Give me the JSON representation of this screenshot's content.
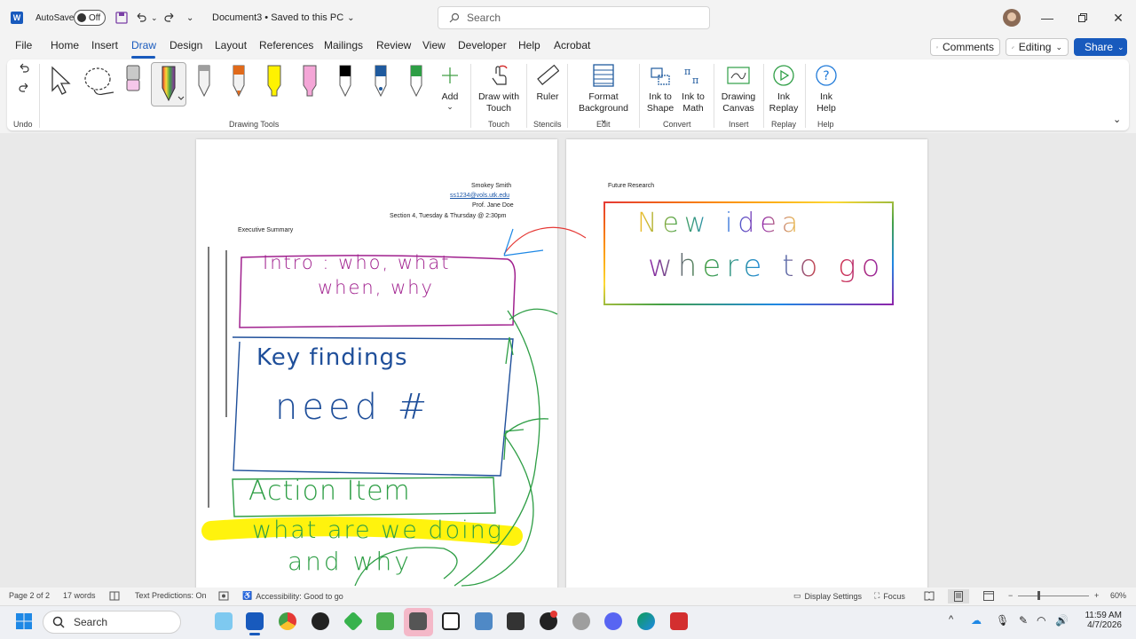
{
  "titlebar": {
    "autosave_label": "AutoSave",
    "autosave_state": "Off",
    "doc_title": "Document3 • Saved to this PC",
    "search_placeholder": "Search"
  },
  "menu": {
    "items": [
      "File",
      "Home",
      "Insert",
      "Draw",
      "Design",
      "Layout",
      "References",
      "Mailings",
      "Review",
      "View",
      "Developer",
      "Help",
      "Acrobat"
    ],
    "active": "Draw",
    "comments_label": "Comments",
    "editing_label": "Editing",
    "share_label": "Share"
  },
  "ribbon": {
    "groups": {
      "undo": "Undo",
      "drawing_tools": "Drawing Tools",
      "touch": "Touch",
      "stencils": "Stencils",
      "edit": "Edit",
      "convert": "Convert",
      "insert": "Insert",
      "replay": "Replay",
      "help": "Help"
    },
    "add_label": "Add",
    "draw_with_touch_1": "Draw with",
    "draw_with_touch_2": "Touch",
    "ruler_label": "Ruler",
    "format_bg_1": "Format",
    "format_bg_2": "Background",
    "ink_shape_1": "Ink to",
    "ink_shape_2": "Shape",
    "ink_math_1": "Ink to",
    "ink_math_2": "Math",
    "drawing_canvas_1": "Drawing",
    "drawing_canvas_2": "Canvas",
    "ink_replay_1": "Ink",
    "ink_replay_2": "Replay",
    "ink_help_1": "Ink",
    "ink_help_2": "Help",
    "pen_colors": [
      "#9e9e9e",
      "#f2f2f2",
      "#e06a1b",
      "#fff200",
      "#f4a6d7",
      "#000000",
      "#1f5a9e",
      "#2e9e45"
    ]
  },
  "document": {
    "page1": {
      "name": "Smokey Smith",
      "email": "ss1234@vols.utk.edu",
      "prof": "Prof. Jane Doe",
      "section": "Section 4, Tuesday & Thursday @ 2:30pm",
      "heading": "Executive Summary"
    },
    "page2": {
      "heading": "Future Research"
    },
    "ink": {
      "intro_line1": "Intro : who, what",
      "intro_line2": "when, why",
      "key_findings": "Key findings",
      "need": "need #",
      "action_item": "Action Item",
      "highlight": "what are we doing",
      "and_why": "and why",
      "new_idea": "New idea",
      "where_to_go": "where to go"
    }
  },
  "statusbar": {
    "page": "Page 2 of 2",
    "words": "17 words",
    "predictions": "Text Predictions: On",
    "accessibility": "Accessibility: Good to go",
    "display_settings": "Display Settings",
    "focus": "Focus",
    "zoom": "60%"
  },
  "taskbar": {
    "search_label": "Search",
    "time": "11:59 AM",
    "date": "4/7/2026"
  }
}
